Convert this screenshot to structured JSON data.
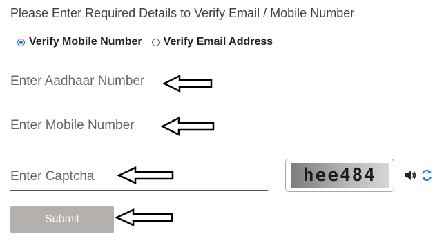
{
  "heading": "Please Enter Required Details to Verify Email / Mobile Number",
  "verify_options": [
    {
      "label": "Verify Mobile Number",
      "selected": true
    },
    {
      "label": "Verify Email Address",
      "selected": false
    }
  ],
  "fields": {
    "aadhaar_placeholder": "Enter Aadhaar Number",
    "mobile_placeholder": "Enter Mobile Number",
    "captcha_placeholder": "Enter Captcha"
  },
  "captcha": {
    "text": "hee484",
    "audio_icon": "speaker-icon",
    "refresh_icon": "refresh-icon"
  },
  "submit_label": "Submit",
  "colors": {
    "accent": "#1a73e8",
    "submit_bg": "#b3b0ae",
    "refresh": "#1f7fbf"
  }
}
